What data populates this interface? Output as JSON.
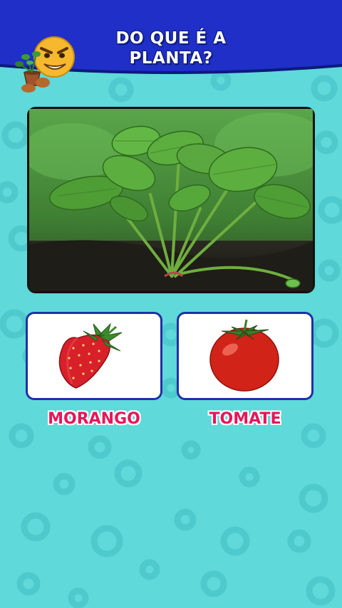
{
  "question": {
    "line1": "DO QUE É A",
    "line2": "PLANTA?"
  },
  "options": [
    {
      "label": "MORANGO",
      "icon": "strawberry-icon"
    },
    {
      "label": "TOMATE",
      "icon": "tomato-icon"
    }
  ],
  "colors": {
    "background": "#5fd9d9",
    "header": "#1f2fc8",
    "answer_text": "#e8155a",
    "card_border": "#2030a8"
  }
}
